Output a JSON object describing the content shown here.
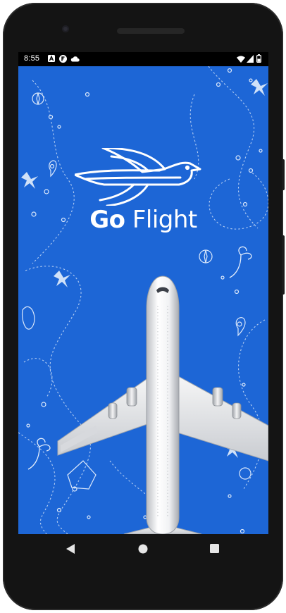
{
  "status_bar": {
    "time": "8:55",
    "left_icons": [
      "a-icon",
      "font-icon",
      "cloud-icon"
    ],
    "right_icons": [
      "wifi-icon",
      "signal-icon",
      "battery-icon"
    ]
  },
  "app": {
    "brand_word_1": "Go",
    "brand_word_2": "Flight",
    "background_color": "#1d66d6",
    "logo_icon": "bird-logo-icon",
    "hero_image": "airplane-top-view"
  },
  "nav_bar": {
    "buttons": [
      "back-triangle",
      "home-circle",
      "recents-square"
    ]
  }
}
